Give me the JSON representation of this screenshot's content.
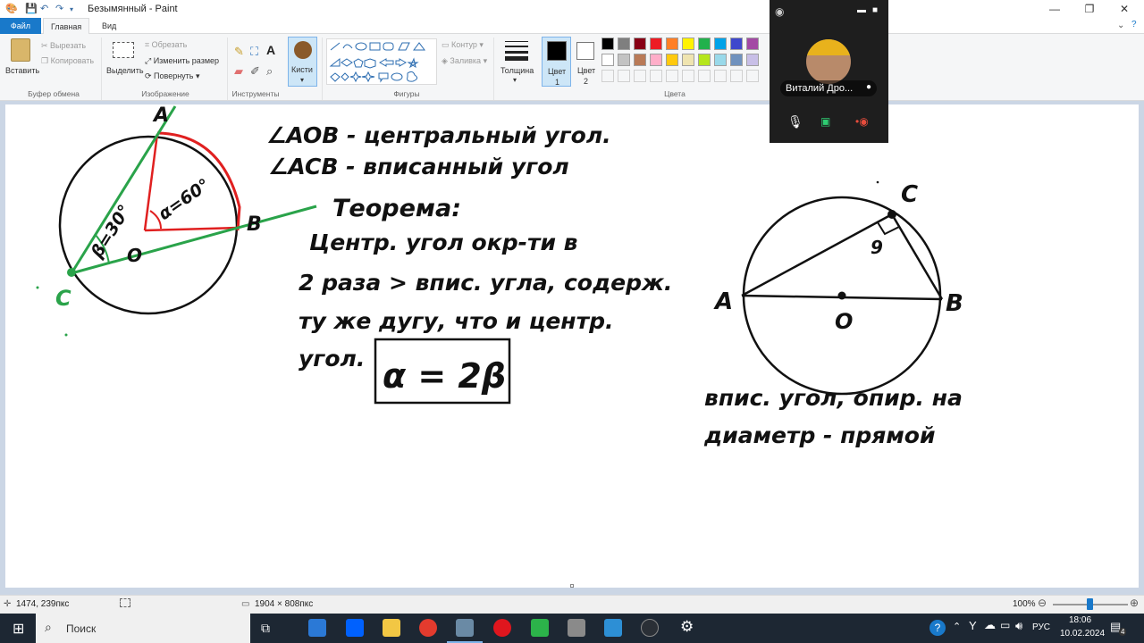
{
  "app": {
    "window_title": "Безымянный - Paint",
    "tabs": [
      {
        "label": "Файл"
      },
      {
        "label": "Главная"
      },
      {
        "label": "Вид"
      }
    ]
  },
  "ribbon": {
    "clipboard": {
      "paste": "Вставить",
      "cut": "Вырезать",
      "copy": "Копировать",
      "group": "Буфер обмена"
    },
    "image": {
      "select": "Выделить",
      "crop": "Обрезать",
      "resize": "Изменить размер",
      "rotate": "Повернуть",
      "group": "Изображение"
    },
    "tools": {
      "group": "Инструменты"
    },
    "brushes": {
      "label": "Кисти"
    },
    "shapes": {
      "outline": "Контур",
      "fill": "Заливка",
      "group": "Фигуры"
    },
    "thickness": {
      "label": "Толщина"
    },
    "color1": {
      "label": "Цвет",
      "index": "1",
      "value": "#000000"
    },
    "color2": {
      "label": "Цвет",
      "index": "2",
      "value": "#ffffff"
    },
    "colors": {
      "group": "Цвета",
      "row1": [
        "#000000",
        "#7f7f7f",
        "#880015",
        "#ed1c24",
        "#ff7f27",
        "#fff200",
        "#22b14c",
        "#00a2e8",
        "#3f48cc",
        "#a349a4"
      ],
      "row2": [
        "#ffffff",
        "#c3c3c3",
        "#b97a57",
        "#ffaec9",
        "#ffc90e",
        "#efe4b0",
        "#b5e61d",
        "#99d9ea",
        "#7092be",
        "#c8bfe7"
      ]
    }
  },
  "call": {
    "participant_name": "Виталий Дро..."
  },
  "canvas": {
    "left_figure": {
      "label_A": "A",
      "label_B": "B",
      "label_C": "C",
      "label_O": "O",
      "angle_beta": "β=30°",
      "angle_alpha": "α=60°"
    },
    "notes": {
      "line1": "∠AOB - центральный угол.",
      "line2": "∠ACB - вписанный угол",
      "theorem_title": "Теорема:",
      "theorem_l1": "Центр. угол окр-ти в",
      "theorem_l2": "2 раза > впис. угла, содерж.",
      "theorem_l3": "ту же дугу, что и центр.",
      "theorem_l4": "угол.",
      "formula": "α = 2β"
    },
    "right_figure": {
      "label_A": "A",
      "label_B": "B",
      "label_C": "C",
      "label_O": "O",
      "right_angle": "9"
    },
    "right_notes": {
      "line1": "впис. угол, опир. на",
      "line2": "диаметр - прямой"
    }
  },
  "status": {
    "cursor_pos": "1474, 239пкс",
    "image_size": "1904 × 808пкс",
    "zoom": "100%"
  },
  "taskbar": {
    "search": "Поиск",
    "lang": "РУС",
    "time": "18:06",
    "date": "10.02.2024",
    "notifications": "4"
  }
}
